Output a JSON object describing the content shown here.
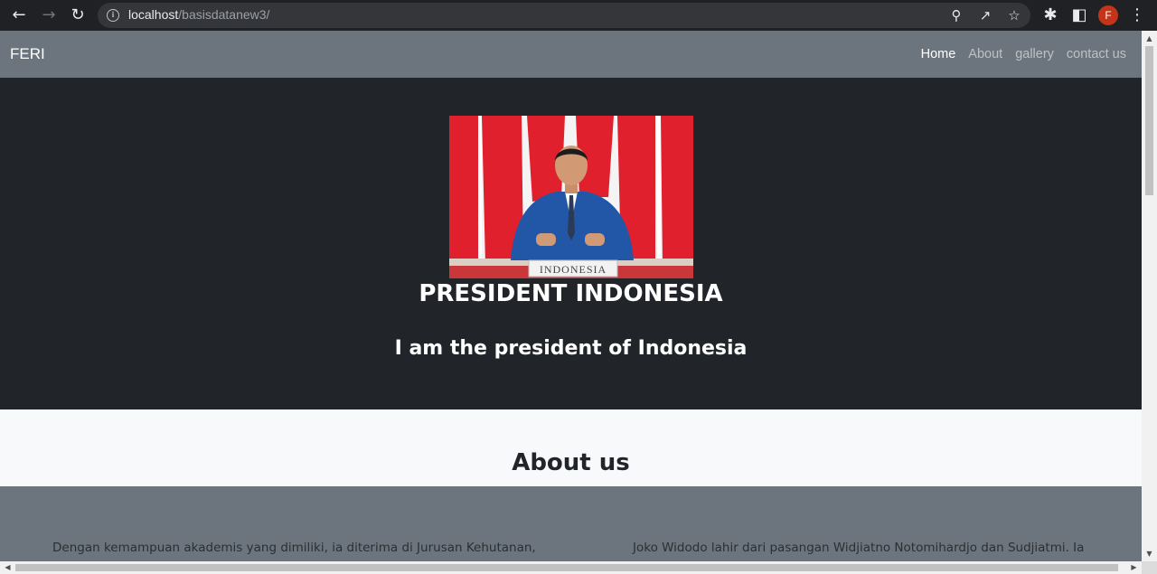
{
  "browser": {
    "url_host": "localhost",
    "url_path": "/basisdatanew3/",
    "profile_initial": "F"
  },
  "navbar": {
    "brand": "FERI",
    "links": [
      "Home",
      "About",
      "gallery",
      "contact us"
    ],
    "active": "Home"
  },
  "hero": {
    "image_caption": "INDONESIA",
    "title": "PRESIDENT INDONESIA",
    "subtitle": "I am the president of Indonesia"
  },
  "about": {
    "title": "About us",
    "col_left": "Dengan kemampuan akademis yang dimiliki, ia diterima di Jurusan Kehutanan,",
    "col_right": "Joko Widodo lahir dari pasangan Widjiatno Notomihardjo dan Sudjiatmi. Ia"
  },
  "colors": {
    "navbar_bg": "#6c757d",
    "hero_bg": "#212529",
    "flag_red": "#e0202d"
  }
}
